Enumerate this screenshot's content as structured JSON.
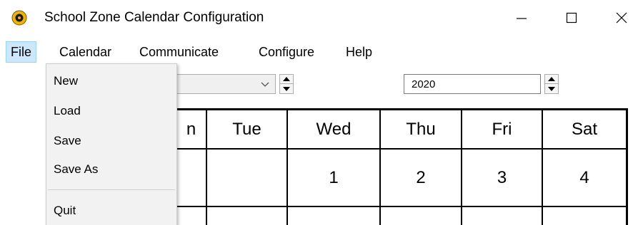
{
  "window": {
    "title": "School Zone Calendar Configuration",
    "icon": "app-icon",
    "controls": {
      "minimize_icon": "minimize-icon",
      "maximize_icon": "maximize-icon",
      "close_icon": "close-icon"
    }
  },
  "menubar": {
    "items": [
      {
        "label": "File",
        "active": true
      },
      {
        "label": "Calendar",
        "active": false
      },
      {
        "label": "Communicate",
        "active": false
      },
      {
        "label": "Configure",
        "active": false
      },
      {
        "label": "Help",
        "active": false
      }
    ]
  },
  "file_menu": {
    "items": [
      "New",
      "Load",
      "Save",
      "Save As",
      "Quit"
    ]
  },
  "toolbar": {
    "month_value": "",
    "year_value": "2020"
  },
  "calendar": {
    "headers": [
      "n",
      "Tue",
      "Wed",
      "Thu",
      "Fri",
      "Sat"
    ],
    "row1": [
      "",
      "",
      "1",
      "2",
      "3",
      "4"
    ]
  },
  "colors": {
    "menu_active_bg": "#cce8ff",
    "dropdown_bg": "#f2f2f2"
  }
}
